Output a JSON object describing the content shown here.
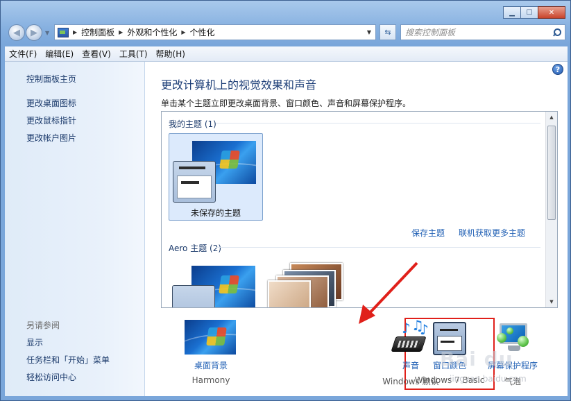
{
  "window": {
    "minimize": "▁",
    "maximize": "☐",
    "close": "✕"
  },
  "address": {
    "crumbs": [
      "控制面板",
      "外观和个性化",
      "个性化"
    ]
  },
  "search": {
    "placeholder": "搜索控制面板"
  },
  "menu": [
    "文件(F)",
    "编辑(E)",
    "查看(V)",
    "工具(T)",
    "帮助(H)"
  ],
  "sidebar": {
    "home": "控制面板主页",
    "links": [
      "更改桌面图标",
      "更改鼠标指针",
      "更改帐户图片"
    ],
    "see_also_heading": "另请参阅",
    "see_also": [
      "显示",
      "任务栏和「开始」菜单",
      "轻松访问中心"
    ]
  },
  "main": {
    "title": "更改计算机上的视觉效果和声音",
    "description": "单击某个主题立即更改桌面背景、窗口颜色、声音和屏幕保护程序。",
    "my_themes_label": "我的主题 (1)",
    "unsaved_theme": "未保存的主题",
    "save_theme": "保存主题",
    "get_more_themes": "联机获取更多主题",
    "aero_themes_label": "Aero 主题 (2)"
  },
  "tiles": [
    {
      "label": "桌面背景",
      "sub": "Harmony"
    },
    {
      "label": "窗口颜色",
      "sub": "Windows 7 Basic"
    },
    {
      "label": "声音",
      "sub": "Windows 默认"
    },
    {
      "label": "屏幕保护程序",
      "sub": "气泡"
    }
  ],
  "watermark": {
    "text": "Bai du",
    "url": "jingyan.baidu.com"
  },
  "colors": {
    "link": "#1f5fb4",
    "title": "#1e3f78",
    "highlight": "#e0201a"
  }
}
